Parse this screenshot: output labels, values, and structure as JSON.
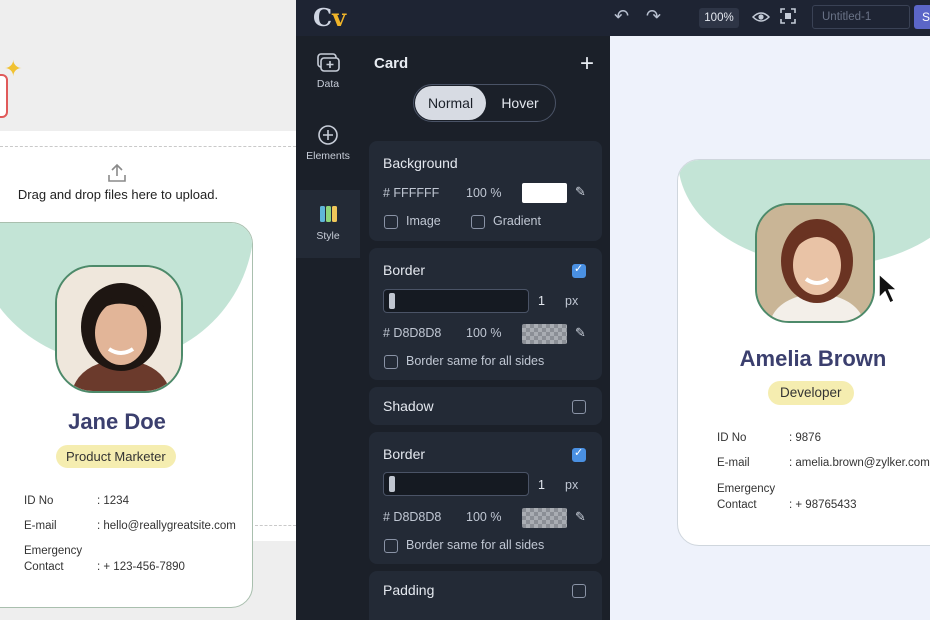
{
  "left": {
    "upload_text": "Drag and drop files here to upload.",
    "card": {
      "name": "Jane Doe",
      "role": "Product Marketer",
      "fields": [
        {
          "label": "ID No",
          "value": ": 1234"
        },
        {
          "label": "E-mail",
          "value": ": hello@reallygreatsite.com"
        },
        {
          "label": "Emergency",
          "label2": "Contact",
          "value": ": + 123-456-7890"
        }
      ]
    }
  },
  "topbar": {
    "logo": "C",
    "logo_accent": "v",
    "zoom": "100%",
    "title_placeholder": "Untitled-1",
    "save_label": "S"
  },
  "rail": {
    "items": [
      {
        "label": "Data",
        "icon": "data-icon"
      },
      {
        "label": "Elements",
        "icon": "plus-circle-icon"
      },
      {
        "label": "Style",
        "icon": "style-icon",
        "active": true
      }
    ]
  },
  "panel": {
    "title": "Card",
    "tabs": {
      "normal": "Normal",
      "hover": "Hover"
    },
    "background": {
      "title": "Background",
      "hex": "# FFFFFF",
      "opacity": "100 %",
      "image_label": "Image",
      "gradient_label": "Gradient"
    },
    "border1": {
      "title": "Border",
      "checked": true,
      "width": "1",
      "unit": "px",
      "hex": "# D8D8D8",
      "opacity": "100 %",
      "same_label": "Border same for all sides"
    },
    "shadow": {
      "title": "Shadow",
      "checked": false
    },
    "border2": {
      "title": "Border",
      "checked": true,
      "width": "1",
      "unit": "px",
      "hex": "# D8D8D8",
      "opacity": "100 %",
      "same_label": "Border same for all sides"
    },
    "padding": {
      "title": "Padding",
      "checked": false
    }
  },
  "preview": {
    "card": {
      "name": "Amelia Brown",
      "role": "Developer",
      "fields": [
        {
          "label": "ID No",
          "value": ": 9876"
        },
        {
          "label": "E-mail",
          "value": ": amelia.brown@zylker.com"
        },
        {
          "label": "Emergency",
          "label2": "Contact",
          "value": ": + 98765433"
        }
      ]
    }
  },
  "colors": {
    "accent_green": "#c3e4d6",
    "badge_yellow": "#f5edb0",
    "name_navy": "#3b3f6e",
    "editor_bg": "#1b2029"
  }
}
